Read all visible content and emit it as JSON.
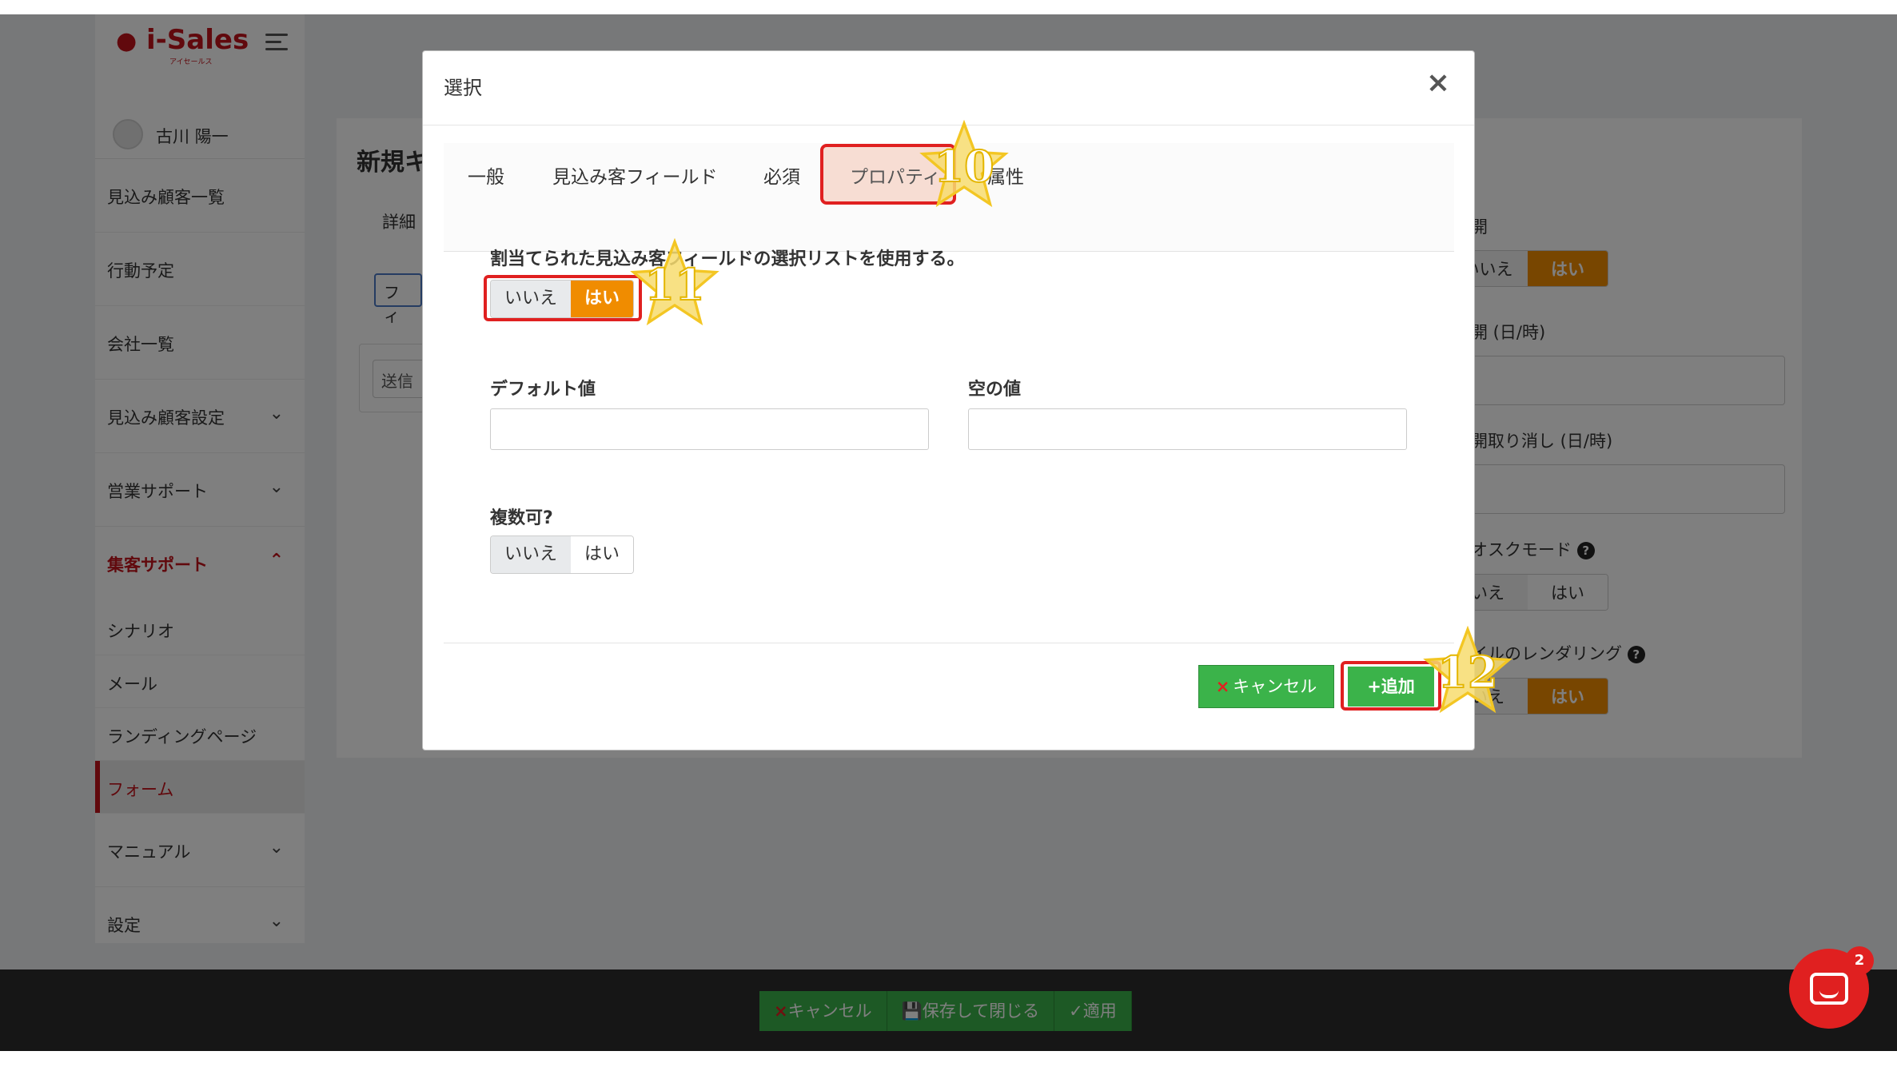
{
  "app": {
    "logo_text": "i-Sales",
    "logo_sub": "アイセールス",
    "user_name": "古川 陽一"
  },
  "sidebar": {
    "items": [
      {
        "label": "見込み顧客一覧"
      },
      {
        "label": "行動予定"
      },
      {
        "label": "会社一覧"
      },
      {
        "label": "見込み顧客設定",
        "chevron": "down"
      },
      {
        "label": "営業サポート",
        "chevron": "down"
      },
      {
        "label": "集客サポート",
        "chevron": "up",
        "active": true
      },
      {
        "label": "マニュアル",
        "chevron": "down"
      },
      {
        "label": "設定",
        "chevron": "down"
      }
    ],
    "sub_items": [
      {
        "label": "シナリオ"
      },
      {
        "label": "メール"
      },
      {
        "label": "ランディングページ"
      },
      {
        "label": "フォーム",
        "active": true
      }
    ]
  },
  "background": {
    "title_partial": "新規キ",
    "tab_partial": "詳細",
    "button_partial": "フィ",
    "send_partial": "送信",
    "right": {
      "label1": "開",
      "label2": "開 (日/時)",
      "label3": "開取り消し (日/時)",
      "label4": "オスクモード",
      "label5": "イルのレンダリング",
      "toggle_no_partial": "いいえ",
      "toggle_no_partial2": "いえ",
      "toggle_yes": "はい"
    }
  },
  "modal": {
    "title": "選択",
    "close": "×",
    "tabs": [
      {
        "label": "一般"
      },
      {
        "label": "見込み客フィールド"
      },
      {
        "label": "必須"
      },
      {
        "label": "プロパティ",
        "active": true
      },
      {
        "label": "属性"
      }
    ],
    "use_list_label": "割当てられた見込み客フィールドの選択リストを使用する。",
    "use_list_no": "いいえ",
    "use_list_yes": "はい",
    "default_value_label": "デフォルト値",
    "default_value": "",
    "empty_value_label": "空の値",
    "empty_value": "",
    "multiple_label": "複数可?",
    "multiple_no": "いいえ",
    "multiple_yes": "はい",
    "cancel_label": "キャンセル",
    "cancel_icon": "×",
    "add_label": "追加",
    "add_icon": "+"
  },
  "footer": {
    "cancel": "キャンセル",
    "save_close": "保存して閉じる",
    "apply": "適用"
  },
  "annotations": {
    "step10": "10",
    "step11": "11",
    "step12": "12"
  },
  "chat": {
    "badge": "2"
  },
  "colors": {
    "brand": "#c3121a",
    "accent_orange": "#f08c00",
    "button_green": "#3bb34a",
    "highlight_red": "#e02020",
    "star_yellow": "#f6d64a"
  }
}
